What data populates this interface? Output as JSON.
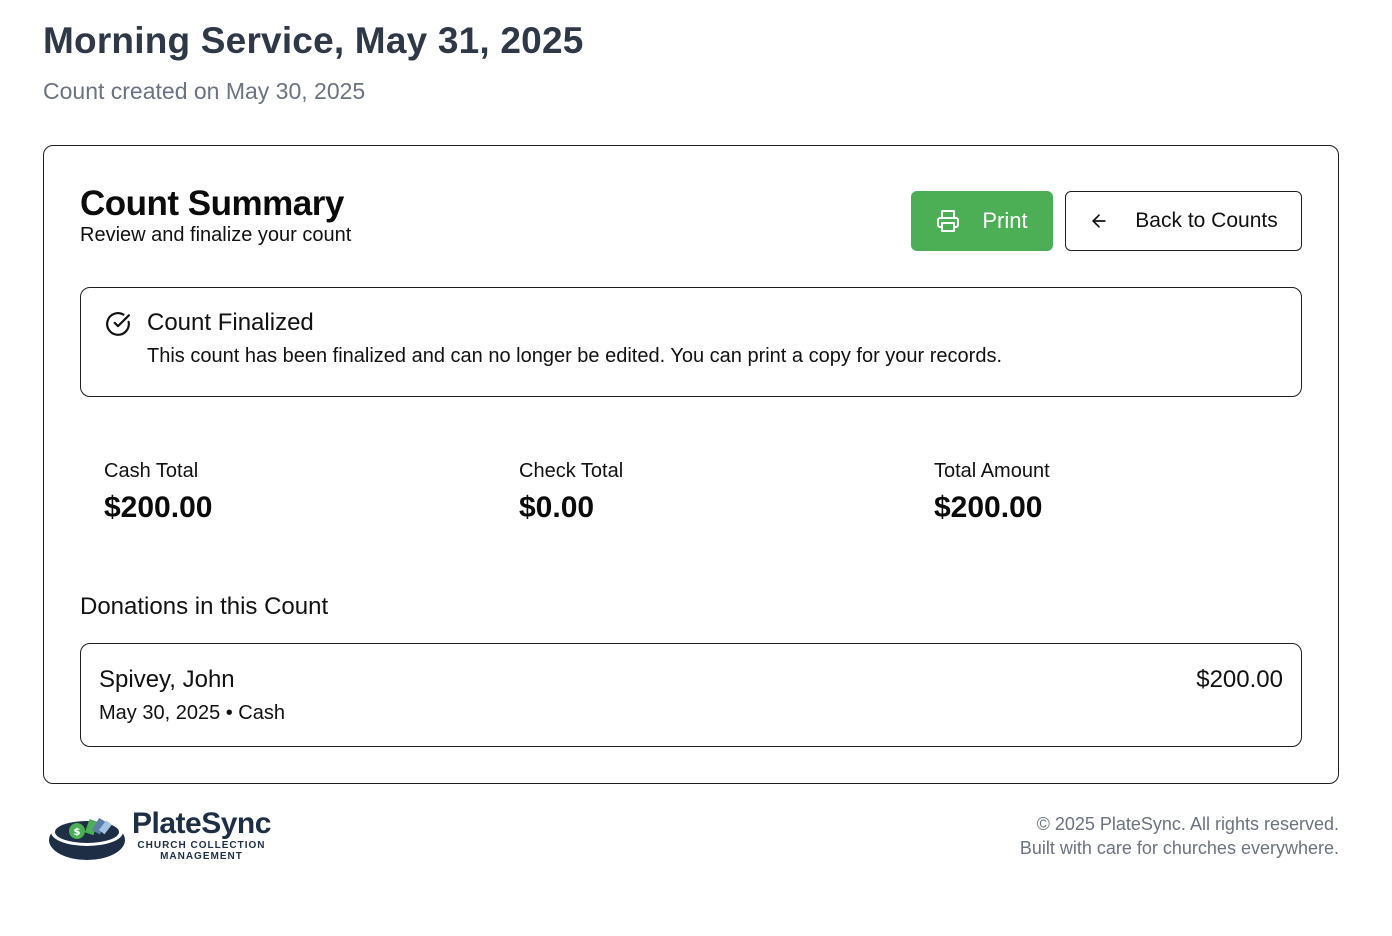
{
  "header": {
    "title": "Morning Service, May 31, 2025",
    "subtitle": "Count created on May 30, 2025"
  },
  "summary": {
    "title": "Count Summary",
    "subtitle": "Review and finalize your count",
    "print_label": "Print",
    "back_label": "Back to Counts",
    "print_color": "#4caf55"
  },
  "alert": {
    "icon": "check-circle-icon",
    "title": "Count Finalized",
    "text": "This count has been finalized and can no longer be edited. You can print a copy for your records."
  },
  "totals": [
    {
      "label": "Cash Total",
      "value": "$200.00"
    },
    {
      "label": "Check Total",
      "value": "$0.00"
    },
    {
      "label": "Total Amount",
      "value": "$200.00"
    }
  ],
  "donations": {
    "heading": "Donations in this Count",
    "items": [
      {
        "name": "Spivey, John",
        "meta": "May 30, 2025 • Cash",
        "amount": "$200.00"
      }
    ]
  },
  "footer": {
    "logo_name": "PlateSync",
    "logo_tagline_1": "CHURCH COLLECTION",
    "logo_tagline_2": "MANAGEMENT",
    "copyright": "© 2025 PlateSync. All rights reserved.",
    "tagline": "Built with care for churches everywhere."
  }
}
